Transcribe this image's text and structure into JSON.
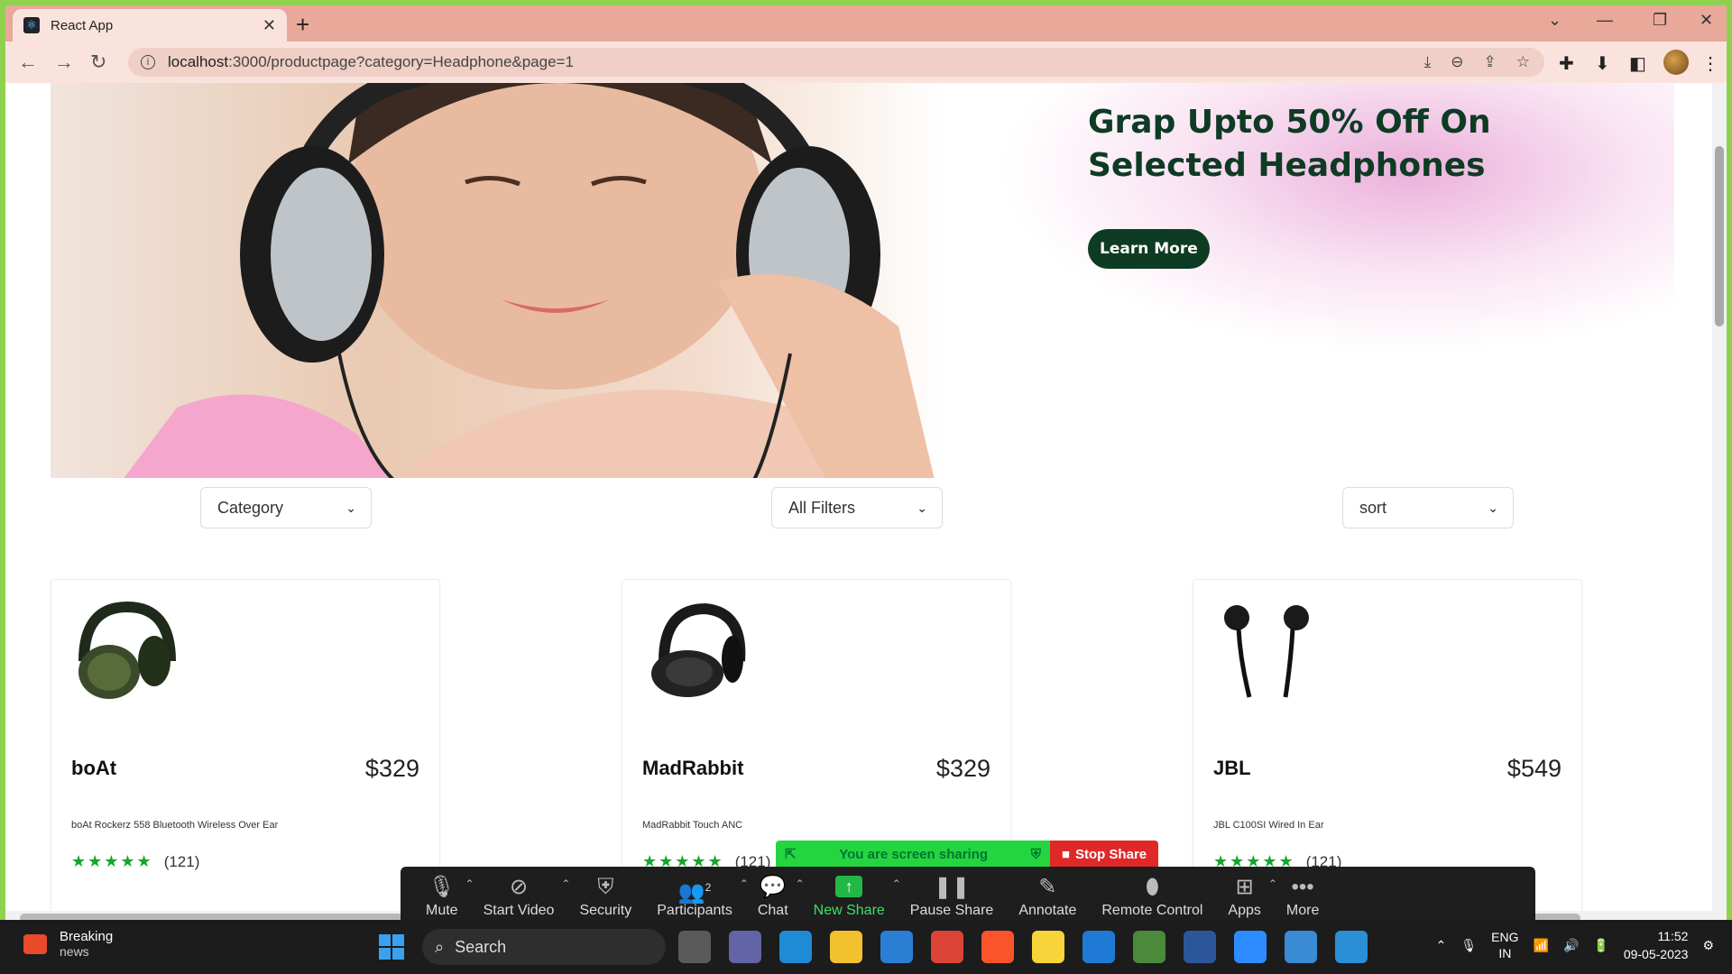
{
  "browser": {
    "tab_title": "React App",
    "tab_close": "✕",
    "new_tab": "+",
    "url_host": "localhost",
    "url_rest": ":3000/productpage?category=Headphone&page=1"
  },
  "banner": {
    "headline": "Grap Upto 50% Off On Selected Headphones",
    "cta": "Learn More"
  },
  "filters": {
    "category": "Category",
    "all_filters": "All Filters",
    "sort": "sort"
  },
  "products": [
    {
      "brand": "boAt",
      "price": "$329",
      "desc": "boAt Rockerz 558 Bluetooth Wireless Over Ear",
      "stars": "★★★★★",
      "count": "(121)"
    },
    {
      "brand": "MadRabbit",
      "price": "$329",
      "desc": "MadRabbit Touch ANC",
      "stars": "★★★★★",
      "count": "(121)"
    },
    {
      "brand": "JBL",
      "price": "$549",
      "desc": "JBL C100SI Wired In Ear",
      "stars": "★★★★★",
      "count": "(121)"
    }
  ],
  "zoom": {
    "sharing_text": "You are screen sharing",
    "stop_share": "Stop Share",
    "participants_count": "2",
    "items": [
      "Mute",
      "Start Video",
      "Security",
      "Participants",
      "Chat",
      "New Share",
      "Pause Share",
      "Annotate",
      "Remote Control",
      "Apps",
      "More"
    ]
  },
  "taskbar": {
    "news_title": "Breaking",
    "news_sub": "news",
    "search": "Search",
    "lang1": "ENG",
    "lang2": "IN",
    "time": "11:52",
    "date": "09-05-2023"
  },
  "colors": {
    "accent_green": "#0e3b24",
    "star_green": "#15a52d",
    "tab_bar": "#e8a89a"
  }
}
